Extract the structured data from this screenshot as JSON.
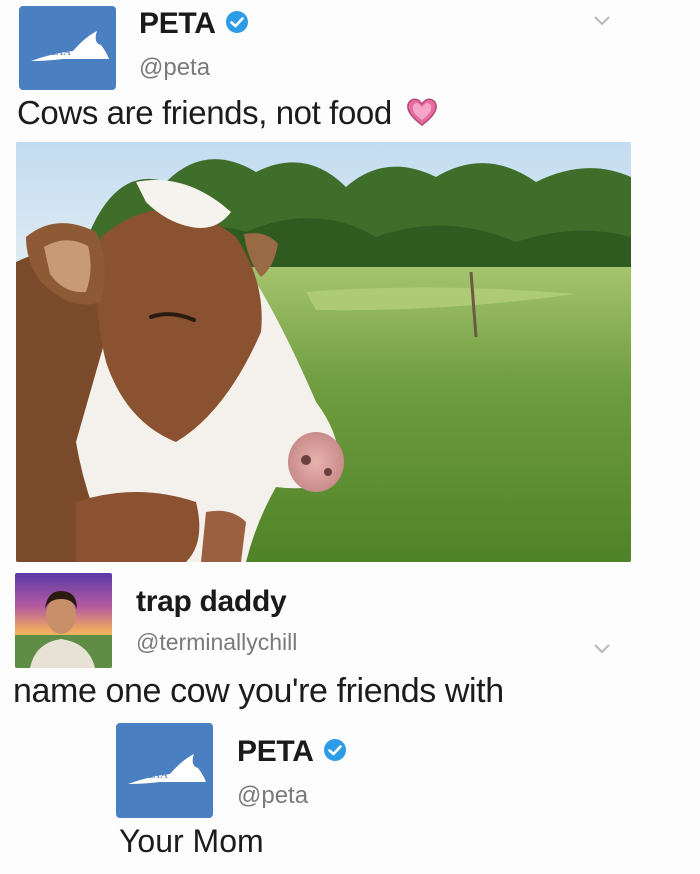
{
  "tweet1": {
    "name": "PETA",
    "handle": "@peta",
    "text": "Cows are friends, not food",
    "avatar_text": "PETA",
    "emoji": "pink-heart-icon"
  },
  "reply1": {
    "name": "trap daddy",
    "handle": "@terminallychill",
    "text": "name one cow you're friends with"
  },
  "reply2": {
    "name": "PETA",
    "handle": "@peta",
    "text": "Your Mom",
    "avatar_text": "PETA"
  },
  "colors": {
    "peta_blue": "#4a7fc1",
    "verified_blue": "#2d9ce6",
    "handle_gray": "#7a7a7a"
  }
}
